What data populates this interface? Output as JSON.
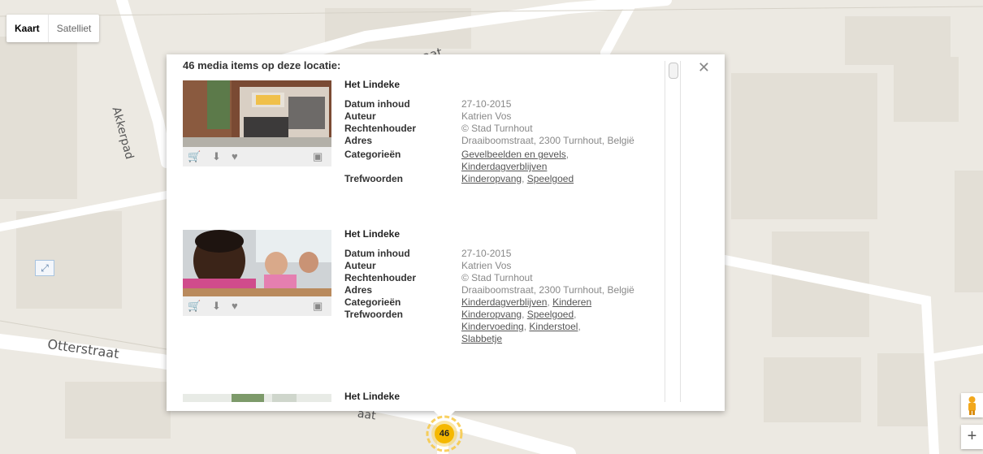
{
  "map": {
    "type_buttons": [
      {
        "label": "Kaart",
        "active": true
      },
      {
        "label": "Satelliet",
        "active": false
      }
    ],
    "street_labels": {
      "akkerpad": "Akkerpad",
      "otterstraat": "Otterstraat",
      "top_fragment": "aat",
      "bottom_fragment": "aat"
    },
    "cluster_count": "46",
    "cluster_color": "#f5b800"
  },
  "popup": {
    "title": "46 media items op deze locatie:",
    "close_label": "✕",
    "items": [
      {
        "title": "Het Lindeke",
        "labels": {
          "date": "Datum inhoud",
          "author": "Auteur",
          "rights": "Rechtenhouder",
          "address": "Adres",
          "categories": "Categorieën",
          "keywords": "Trefwoorden"
        },
        "date": "27-10-2015",
        "author": "Katrien Vos",
        "rights": "© Stad Turnhout",
        "address": "Draaiboomstraat, 2300 Turnhout, België",
        "categories": [
          "Gevelbeelden en gevels",
          "Kinderdagverblijven"
        ],
        "keywords": [
          "Kinderopvang",
          "Speelgoed"
        ]
      },
      {
        "title": "Het Lindeke",
        "labels": {
          "date": "Datum inhoud",
          "author": "Auteur",
          "rights": "Rechtenhouder",
          "address": "Adres",
          "categories": "Categorieën",
          "keywords": "Trefwoorden"
        },
        "date": "27-10-2015",
        "author": "Katrien Vos",
        "rights": "© Stad Turnhout",
        "address": "Draaiboomstraat, 2300 Turnhout, België",
        "categories": [
          "Kinderdagverblijven",
          "Kinderen"
        ],
        "keywords": [
          "Kinderopvang",
          "Speelgoed",
          "Kindervoeding",
          "Kinderstoel",
          "Slabbetje"
        ]
      },
      {
        "title": "Het Lindeke"
      }
    ]
  },
  "icons": {
    "cart": "shopping-cart-icon",
    "download": "download-icon",
    "favorite": "heart-icon",
    "image": "image-icon",
    "fullscreen": "fullscreen-icon",
    "pegman": "pegman-icon",
    "zoom_in": "zoom-in-icon"
  },
  "controls": {
    "zoom_in_label": "+"
  }
}
